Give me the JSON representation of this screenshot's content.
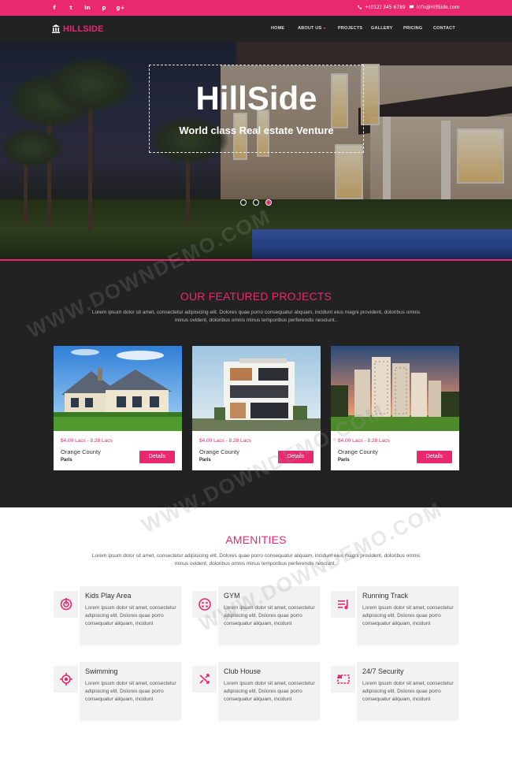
{
  "topbar": {
    "social": [
      {
        "icon": "facebook-icon",
        "glyph": "f"
      },
      {
        "icon": "twitter-icon",
        "glyph": "t"
      },
      {
        "icon": "linkedin-icon",
        "glyph": "in"
      },
      {
        "icon": "pinterest-icon",
        "glyph": "p"
      },
      {
        "icon": "google-plus-icon",
        "glyph": "g+"
      }
    ],
    "phone": "+(012) 345 6789",
    "email": "info@HillSide.com"
  },
  "nav": {
    "logo_text": "HILLSIDE",
    "items": [
      {
        "label": "HOME"
      },
      {
        "label": "ABOUT US"
      },
      {
        "label": "PROJECTS"
      },
      {
        "label": "GALLERY"
      },
      {
        "label": "PRICING"
      },
      {
        "label": "CONTACT"
      }
    ]
  },
  "hero": {
    "title": "HillSide",
    "subtitle": "World class Real estate Venture",
    "slide_count": 3,
    "active_slide": 3
  },
  "featured": {
    "title": "OUR FEATURED PROJECTS",
    "description": "Lorem ipsum dolor sit amet, consectetur adipisicing elit. Dolores quae porro consequatur aliquam, incidunt eius magni provident, doloribus omnis minus ovident, doloribus omnis minus temporibus perferendis nesciunt..",
    "projects": [
      {
        "price": "$4.00 Lacs - 8.28 Lacs",
        "name": "Orange County",
        "city": "Paris",
        "button": "Details"
      },
      {
        "price": "$4.00 Lacs - 8.28 Lacs",
        "name": "Orange County",
        "city": "Paris",
        "button": "Details"
      },
      {
        "price": "$4.00 Lacs - 8.28 Lacs",
        "name": "Orange County",
        "city": "Paris",
        "button": "Details"
      }
    ]
  },
  "amenities": {
    "title": "AMENITIES",
    "description": "Lorem ipsum dolor sit amet, consectetur adipisicing elit. Dolores quae porro consequatur aliquam, incidunt eius magni provident, doloribus omnis minus ovident, doloribus omnis minus temporibus perferendis nesciunt..",
    "items": [
      {
        "icon": "kids-play-icon",
        "title": "Kids Play Area",
        "text": "Lorem ipsum dolor sit amet, consectetur adipisicing elit. Dolores quae porro consequatur aliquam, incidunt"
      },
      {
        "icon": "gym-icon",
        "title": "GYM",
        "text": "Lorem ipsum dolor sit amet, consectetur adipisicing elit. Dolores quae porro consequatur aliquam, incidunt"
      },
      {
        "icon": "running-track-icon",
        "title": "Running Track",
        "text": "Lorem ipsum dolor sit amet, consectetur adipisicing elit. Dolores quae porro consequatur aliquam, incidunt"
      },
      {
        "icon": "swimming-icon",
        "title": "Swimming",
        "text": "Lorem ipsum dolor sit amet, consectetur adipisicing elit. Dolores quae porro consequatur aliquam, incidunt"
      },
      {
        "icon": "club-house-icon",
        "title": "Club House",
        "text": "Lorem ipsum dolor sit amet, consectetur adipisicing elit. Dolores quae porro consequatur aliquam, incidunt"
      },
      {
        "icon": "security-icon",
        "title": "24/7 Security",
        "text": "Lorem ipsum dolor sit amet, consectetur adipisicing elit. Dolores quae porro consequatur aliquam, incidunt"
      }
    ]
  },
  "watermark": "WWW.DOWNDEMO.COM",
  "colors": {
    "accent": "#e9286f",
    "dark": "#222222",
    "card_bg": "#f2f2f2"
  }
}
